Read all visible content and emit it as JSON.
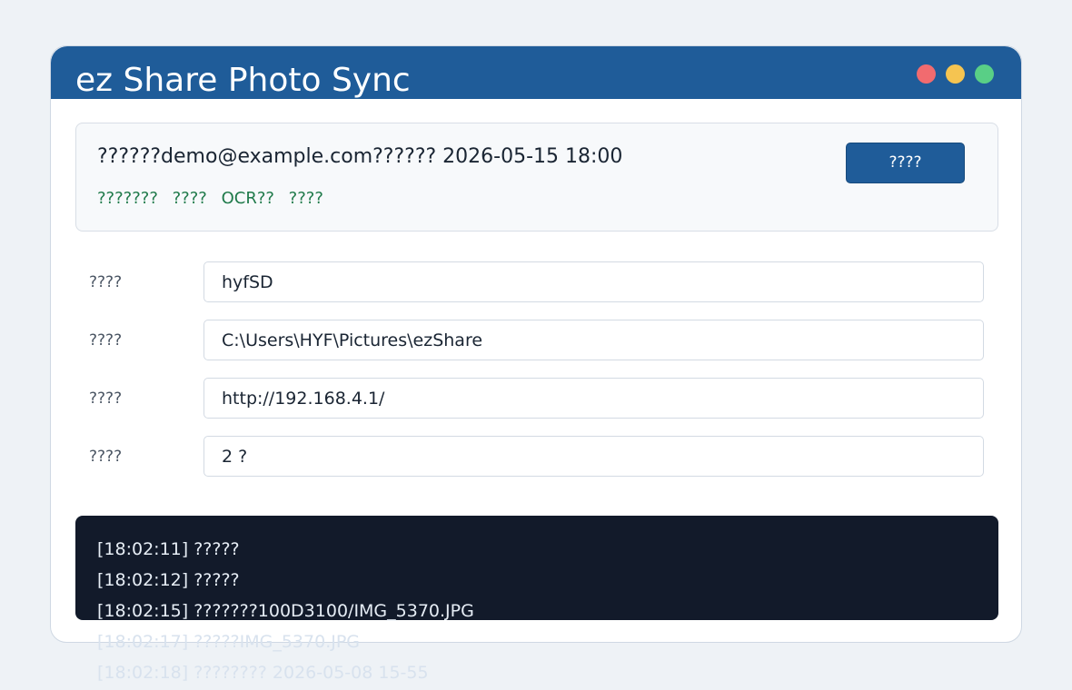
{
  "app": {
    "title": "ez Share Photo Sync"
  },
  "window_controls": {
    "close_color": "#f16b6f",
    "minimize_color": "#f5c451",
    "maximize_color": "#59cf86"
  },
  "status": {
    "account_line": "??????demo@example.com?????? 2026-05-15 18:00",
    "features": [
      "???????",
      "????",
      "OCR??",
      "????"
    ],
    "action_button_label": "????"
  },
  "form": {
    "fields": [
      {
        "label": "????",
        "value": "hyfSD"
      },
      {
        "label": "????",
        "value": "C:\\Users\\HYF\\Pictures\\ezShare"
      },
      {
        "label": "????",
        "value": "http://192.168.4.1/"
      },
      {
        "label": "????",
        "value": "2 ?"
      }
    ]
  },
  "log": {
    "lines": [
      "[18:02:11] ?????",
      "[18:02:12] ?????",
      "[18:02:15] ???????100D3100/IMG_5370.JPG",
      "[18:02:17] ?????IMG_5370.JPG",
      "[18:02:18] ???????? 2026-05-08 15-55"
    ]
  },
  "colors": {
    "accent": "#1f5c99",
    "success_text": "#1f7a4a",
    "log_background": "#121a2a"
  }
}
